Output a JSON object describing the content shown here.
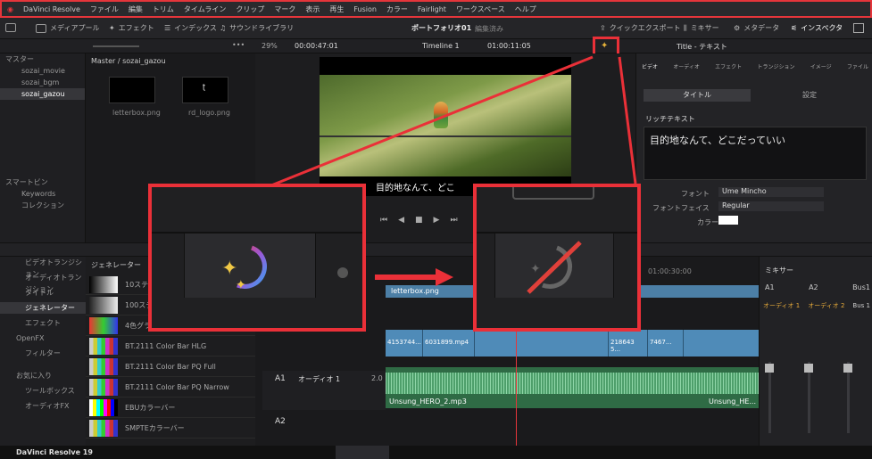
{
  "app": {
    "name": "DaVinci Resolve",
    "footer_name": "DaVinci Resolve 19"
  },
  "menu": [
    "ファイル",
    "編集",
    "トリム",
    "タイムライン",
    "クリップ",
    "マーク",
    "表示",
    "再生",
    "Fusion",
    "カラー",
    "Fairlight",
    "ワークスペース",
    "ヘルプ"
  ],
  "toolbar": {
    "media_pool": "メディアプール",
    "effects": "エフェクト",
    "index": "インデックス",
    "sound_library": "サウンドライブラリ",
    "project": "ポートフォリオ01",
    "status": "編集済み",
    "quick_export": "クイックエクスポート",
    "mixer": "ミキサー",
    "metadata": "メタデータ",
    "inspector": "インスペクタ"
  },
  "subbar": {
    "zoom": "29%",
    "src_tc": "00:00:47:01",
    "timeline": "Timeline 1",
    "rec_tc": "01:00:11:05",
    "inspector_title": "Title - テキスト"
  },
  "bins": {
    "root": "マスター",
    "items": [
      "sozai_movie",
      "sozai_bgm",
      "sozai_gazou"
    ],
    "smart": "スマートビン",
    "smart_items": [
      "Keywords",
      "コレクション"
    ]
  },
  "media": {
    "path": "Master / sozai_gazou",
    "clips": [
      "letterbox.png",
      "rd_logo.png"
    ]
  },
  "viewer": {
    "subtitle": "目的地なんて、どこ"
  },
  "inspector": {
    "tabs": [
      "ビデオ",
      "オーディオ",
      "エフェクト",
      "トランジション",
      "イメージ",
      "ファイル"
    ],
    "subtabs": [
      "タイトル",
      "設定"
    ],
    "rich_text": "リッチテキスト",
    "text": "目的地なんて、どこだっていい",
    "font_label": "フォント",
    "font_value": "Ume Mincho",
    "face_label": "フォントフェイス",
    "face_value": "Regular",
    "color_label": "カラー"
  },
  "effects_lib": {
    "items": [
      "ビデオトランジション",
      "オーディオトランジション",
      "タイトル",
      "ジェネレーター",
      "エフェクト",
      "OpenFX",
      "フィルター",
      "お気に入り",
      "ツールボックス",
      "オーディオFX"
    ],
    "selected": "ジェネレーター"
  },
  "effects_list": {
    "header": "ジェネレーター",
    "items": [
      "10ステップ",
      "100ステップ",
      "4色グラデ",
      "BT.2111 Color Bar HLG",
      "BT.2111 Color Bar PQ Full",
      "BT.2111 Color Bar PQ Narrow",
      "EBUカラーバー",
      "SMPTEカラーバー"
    ]
  },
  "timeline": {
    "ruler_tc": "01:00:30:00",
    "title_clip": "letterbox.png",
    "video_clips": [
      "4153744...",
      "6031899.mp4",
      "218643 5...",
      "7467..."
    ],
    "track_a1": "A1",
    "a1_name": "オーディオ 1",
    "a1_level": "2.0",
    "track_a2": "A2",
    "audio_clip_1": "Unsung_HERO_2.mp3",
    "audio_clip_2": "Unsung_HE..."
  },
  "mixer": {
    "title": "ミキサー",
    "channels": [
      "A1",
      "A2",
      "Bus1"
    ],
    "names": [
      "オーディオ 1",
      "オーディオ 2",
      "Bus 1"
    ]
  },
  "colors": {
    "highlight": "#ea3038",
    "accent": "#e5353b"
  }
}
